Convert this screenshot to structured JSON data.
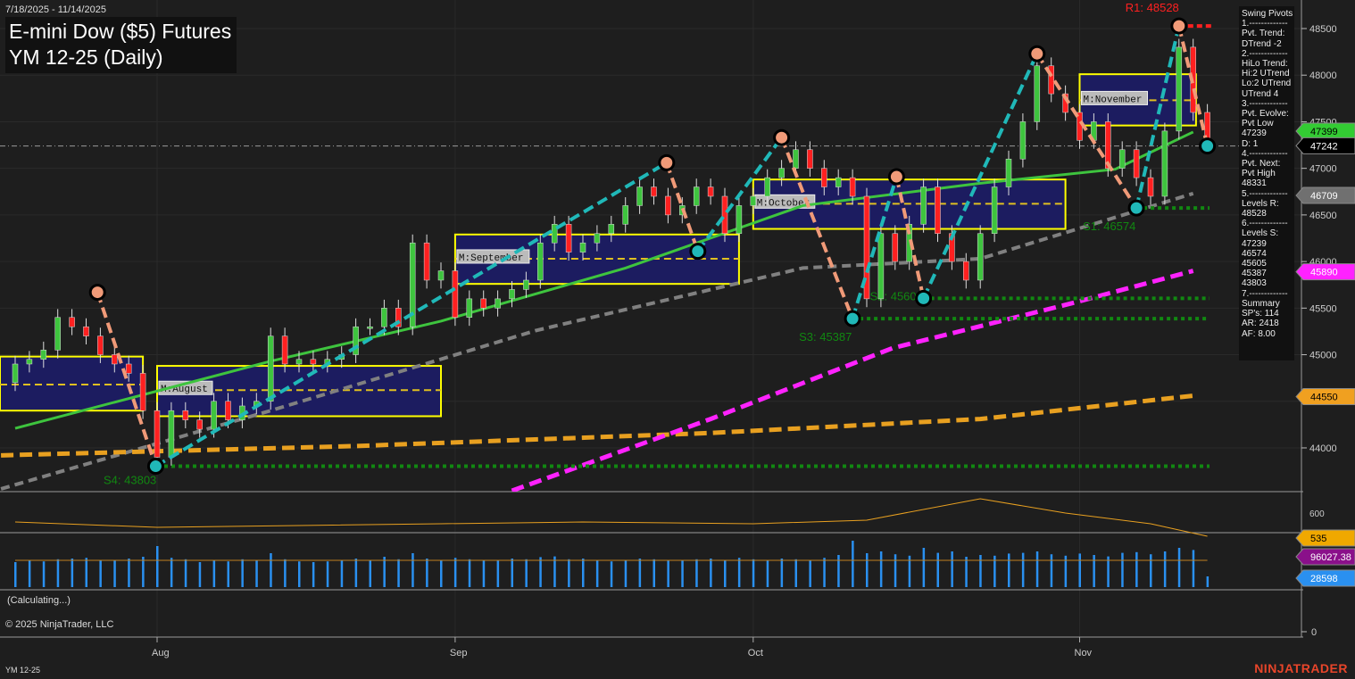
{
  "header": {
    "date_range": "7/18/2025 - 11/14/2025",
    "title_line1": "E-mini Dow ($5) Futures",
    "title_line2": "YM 12-25 (Daily)"
  },
  "info_panel": {
    "lines": [
      "Swing Pivots",
      "1.-------------",
      "Pvt. Trend:",
      "DTrend -2",
      "2.-------------",
      "HiLo Trend:",
      "Hi:2 UTrend",
      "Lo:2 UTrend",
      "UTrend 4",
      "3.-------------",
      "Pvt. Evolve:",
      "Pvt Low",
      "47239",
      "D: 1",
      "4.-------------",
      "Pvt. Next:",
      "Pvt High",
      "48331",
      "5.-------------",
      "Levels R:",
      "48528",
      "6.-------------",
      "Levels S:",
      "47239",
      "46574",
      "45605",
      "45387",
      "43803",
      "7.-------------",
      "Summary",
      "SP's: 114",
      "AR: 2418",
      "AF: 8.00"
    ]
  },
  "footer": {
    "calculating": "(Calculating...)",
    "copyright": "© 2025 NinjaTrader, LLC",
    "instrument": "YM 12-25",
    "brand": "NINJATRADER"
  },
  "colors": {
    "up": "#3ec43e",
    "down": "#ff2020",
    "sma_green": "#3ec43e",
    "sma_gray": "#808080",
    "magenta": "#ff22ff",
    "orange": "#e8a020",
    "cyan": "#20b8b8",
    "salmon": "#f09a78",
    "box": "#ffff00",
    "box_fill": "#1c1c60",
    "level": "#118811"
  },
  "chart_data": {
    "type": "candlestick",
    "title": "E-mini Dow ($5) Futures YM 12-25 (Daily)",
    "x_tick_labels": [
      {
        "label": "Aug",
        "index": 10
      },
      {
        "label": "Sep",
        "index": 31
      },
      {
        "label": "Oct",
        "index": 52
      },
      {
        "label": "Nov",
        "index": 75
      }
    ],
    "ylim": [
      43300,
      48850
    ],
    "y_ticks": [
      44000,
      44500,
      45000,
      45500,
      46000,
      46500,
      47000,
      47500,
      48000,
      48500
    ],
    "closes": [
      44900,
      44950,
      45050,
      45400,
      45300,
      45200,
      45000,
      44900,
      44800,
      44400,
      43900,
      44400,
      44300,
      44200,
      44500,
      44300,
      44450,
      44500,
      45200,
      44900,
      44950,
      44900,
      44950,
      45000,
      45300,
      45300,
      45500,
      45300,
      46200,
      45800,
      45900,
      45400,
      45600,
      45500,
      45600,
      45700,
      45800,
      46200,
      46400,
      46100,
      46200,
      46300,
      46400,
      46600,
      46800,
      46700,
      46500,
      46600,
      46800,
      46700,
      46300,
      46600,
      46700,
      46900,
      47000,
      47200,
      47000,
      46800,
      46900,
      46700,
      45600,
      46300,
      46000,
      46400,
      46800,
      46300,
      46000,
      45800,
      46300,
      46800,
      47100,
      47500,
      48100,
      47800,
      47600,
      47300,
      47500,
      47000,
      47200,
      46900,
      46700,
      47400,
      48300,
      47600,
      47300
    ],
    "first_open": 44700,
    "moving_averages": [
      {
        "name": "green",
        "points": [
          [
            0,
            44210
          ],
          [
            18,
            44930
          ],
          [
            30,
            45360
          ],
          [
            43,
            45930
          ],
          [
            55.5,
            46600
          ],
          [
            68,
            46840
          ],
          [
            77.5,
            46990
          ],
          [
            83,
            47390
          ]
        ]
      },
      {
        "name": "gray",
        "points": [
          [
            -1,
            43560
          ],
          [
            18,
            44400
          ],
          [
            36.7,
            45260
          ],
          [
            55.5,
            45930
          ],
          [
            68,
            46030
          ],
          [
            83,
            46730
          ]
        ]
      },
      {
        "name": "orange",
        "points": [
          [
            -1,
            43920
          ],
          [
            24,
            44020
          ],
          [
            49,
            44160
          ],
          [
            68,
            44310
          ],
          [
            83,
            44560
          ]
        ]
      },
      {
        "name": "magenta",
        "points": [
          [
            35,
            43540
          ],
          [
            49,
            44310
          ],
          [
            61.8,
            45070
          ],
          [
            74.4,
            45550
          ],
          [
            83,
            45900
          ]
        ]
      }
    ],
    "swing_pivots": [
      [
        5.8,
        45670
      ],
      [
        9.9,
        43803
      ],
      [
        45.9,
        47060
      ],
      [
        48.1,
        46110
      ],
      [
        54,
        47330
      ],
      [
        59,
        45387
      ],
      [
        62.1,
        46910
      ],
      [
        64,
        45605
      ],
      [
        72,
        48230
      ],
      [
        79,
        46574
      ],
      [
        82,
        48528
      ],
      [
        84,
        47240
      ]
    ],
    "monthly_boxes": [
      {
        "label": "",
        "start": -1.2,
        "end": 9,
        "high": 44980,
        "low": 44400,
        "mid": 44680
      },
      {
        "label": "M:August",
        "start": 10,
        "end": 30,
        "high": 44880,
        "low": 44340,
        "mid": 44620
      },
      {
        "label": "M:September",
        "start": 31,
        "end": 51,
        "high": 46290,
        "low": 45760,
        "mid": 46030
      },
      {
        "label": "M:October",
        "start": 52,
        "end": 74,
        "high": 46880,
        "low": 46350,
        "mid": 46620
      },
      {
        "label": "M:November",
        "start": 75,
        "end": 83.2,
        "high": 48010,
        "low": 47460,
        "mid": 47730
      }
    ],
    "levels": [
      {
        "label": "S4: 43803",
        "value": 43803,
        "start": 10
      },
      {
        "label": "S3: 45387",
        "value": 45387,
        "start": 59
      },
      {
        "label": "S2: 45605",
        "value": 45605,
        "start": 64
      },
      {
        "label": "S1: 46574",
        "value": 46574,
        "start": 79
      },
      {
        "label": "R1: 48528",
        "value": 48528,
        "start": 82
      }
    ],
    "current_line": 47240,
    "price_markers": [
      {
        "value": 47399,
        "label": "47399",
        "bg": "#33cc33",
        "fg": "#000"
      },
      {
        "value": 47242,
        "label": "47242",
        "bg": "#000",
        "fg": "#fff"
      },
      {
        "value": 46709,
        "label": "46709",
        "bg": "#707070",
        "fg": "#fff"
      },
      {
        "value": 45890,
        "label": "45890",
        "bg": "#ff22ff",
        "fg": "#fff"
      },
      {
        "value": 44550,
        "label": "44550",
        "bg": "#f0a020",
        "fg": "#000"
      }
    ],
    "indicator_panel": {
      "marker": "535",
      "tick": "600",
      "points": [
        [
          0,
          575
        ],
        [
          10,
          560
        ],
        [
          20,
          565
        ],
        [
          30,
          570
        ],
        [
          40,
          575
        ],
        [
          52,
          570
        ],
        [
          60,
          580
        ],
        [
          68,
          640
        ],
        [
          74,
          600
        ],
        [
          80,
          570
        ],
        [
          84,
          535
        ]
      ]
    },
    "volume_panel": {
      "markers": [
        "96027.38",
        "28598"
      ],
      "zero_tick": "0",
      "values": [
        70,
        75,
        72,
        78,
        80,
        82,
        76,
        74,
        80,
        85,
        115,
        82,
        78,
        70,
        75,
        72,
        78,
        74,
        95,
        78,
        72,
        70,
        72,
        75,
        80,
        76,
        85,
        78,
        95,
        80,
        76,
        82,
        78,
        74,
        76,
        80,
        78,
        84,
        86,
        78,
        80,
        76,
        72,
        74,
        80,
        78,
        76,
        74,
        78,
        80,
        76,
        82,
        78,
        74,
        80,
        78,
        76,
        82,
        90,
        130,
        95,
        100,
        92,
        88,
        110,
        96,
        100,
        85,
        90,
        88,
        94,
        96,
        100,
        92,
        88,
        94,
        90,
        86,
        96,
        98,
        92,
        100,
        110,
        104,
        30
      ]
    }
  }
}
